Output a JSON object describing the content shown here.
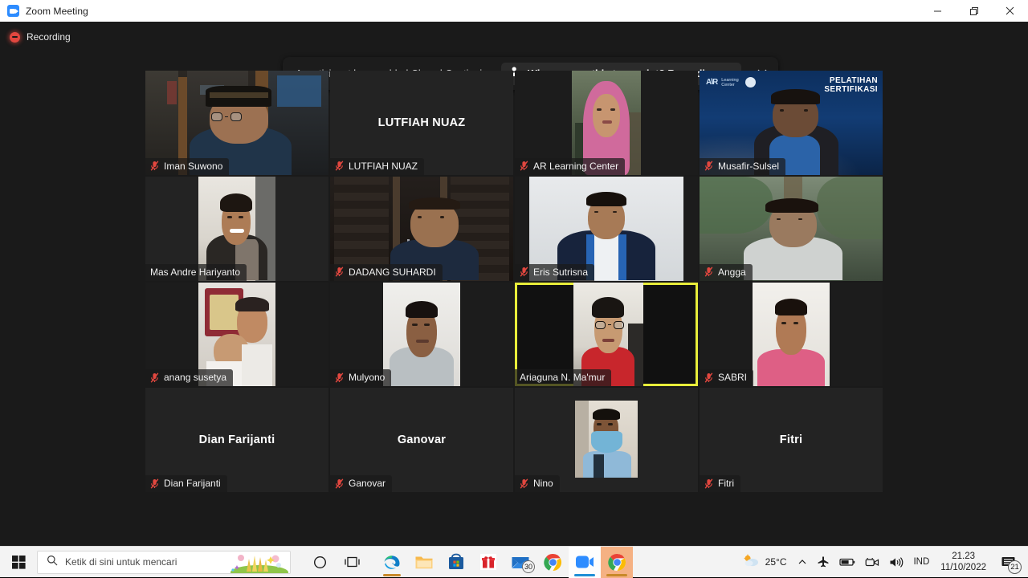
{
  "window": {
    "title": "Zoom Meeting",
    "app_icon": "zoom-icon",
    "controls": {
      "minimize": "–",
      "maximize": "❐",
      "close": "✕"
    }
  },
  "recording": {
    "label": "Recording",
    "icon": "recording-dot-icon"
  },
  "cc_banner": {
    "message": "A participant has enabled Closed Captioning",
    "pill_icon": "person-transcript-icon",
    "pill_label": "Who can see this transcript? Recording on",
    "close_icon": "close-icon"
  },
  "grid": {
    "active_border_color": "#e8ed3a",
    "participants": [
      {
        "name": "Iman Suwono",
        "muted": true,
        "video": true,
        "active": false,
        "kind": "video-shelf"
      },
      {
        "name": "LUTFIAH NUAZ",
        "muted": true,
        "video": false,
        "active": false,
        "kind": "name-only",
        "display_name": "LUTFIAH NUAZ"
      },
      {
        "name": "AR Learning Center",
        "muted": true,
        "video": true,
        "active": false,
        "kind": "video-hijab"
      },
      {
        "name": "Musafir-Sulsel",
        "muted": true,
        "video": true,
        "active": false,
        "kind": "video-backdrop",
        "backdrop_text_top": "PELATIHAN",
        "backdrop_text_bottom": "SERTIFIKASI",
        "backdrop_logo": "AR Learning Center"
      },
      {
        "name": "Mas Andre Hariyanto",
        "muted": false,
        "video": true,
        "active": false,
        "kind": "video-portrait-light"
      },
      {
        "name": "DADANG SUHARDI",
        "muted": true,
        "video": true,
        "active": false,
        "kind": "video-dark-room"
      },
      {
        "name": "Eris Sutrisna",
        "muted": true,
        "video": true,
        "active": false,
        "kind": "video-lanyard"
      },
      {
        "name": "Angga",
        "muted": true,
        "video": true,
        "active": false,
        "kind": "video-outdoor"
      },
      {
        "name": "anang susetya",
        "muted": true,
        "video": true,
        "active": false,
        "kind": "video-two-people"
      },
      {
        "name": "Mulyono",
        "muted": true,
        "video": true,
        "active": false,
        "kind": "video-portrait-white"
      },
      {
        "name": "Ariaguna N. Ma'mur",
        "muted": false,
        "video": true,
        "active": true,
        "kind": "video-red-shirt"
      },
      {
        "name": "SABRI",
        "muted": true,
        "video": true,
        "active": false,
        "kind": "video-pink"
      },
      {
        "name": "Dian Farijanti",
        "muted": true,
        "video": false,
        "active": false,
        "kind": "name-only",
        "display_name": "Dian Farijanti"
      },
      {
        "name": "Ganovar",
        "muted": true,
        "video": false,
        "active": false,
        "kind": "name-only",
        "display_name": "Ganovar"
      },
      {
        "name": "Nino",
        "muted": true,
        "video": true,
        "active": false,
        "kind": "video-mask"
      },
      {
        "name": "Fitri",
        "muted": true,
        "video": false,
        "active": false,
        "kind": "name-only",
        "display_name": "Fitri"
      }
    ]
  },
  "taskbar": {
    "start_icon": "windows-start-icon",
    "search": {
      "icon": "search-icon",
      "placeholder": "Ketik di sini untuk mencari"
    },
    "icons": [
      {
        "name": "cortana-icon",
        "label": ""
      },
      {
        "name": "task-view-icon",
        "label": ""
      },
      {
        "name": "edge-icon",
        "label": ""
      },
      {
        "name": "file-explorer-icon",
        "label": ""
      },
      {
        "name": "microsoft-store-icon",
        "label": ""
      },
      {
        "name": "gift-icon",
        "label": ""
      },
      {
        "name": "mail-icon",
        "label": "",
        "badge": "30"
      },
      {
        "name": "chrome-icon",
        "label": ""
      },
      {
        "name": "zoom-icon",
        "label": ""
      },
      {
        "name": "chrome-active-icon",
        "label": ""
      }
    ],
    "tray": {
      "weather_icon": "sun-cloud-icon",
      "temperature": "25°C",
      "overflow_icon": "chevron-up-icon",
      "airplane_icon": "airplane-mode-icon",
      "battery_icon": "battery-icon",
      "camera_icon": "camera-icon",
      "volume_icon": "volume-icon",
      "language": "IND",
      "time": "21.23",
      "date": "11/10/2022",
      "notification_icon": "notification-icon",
      "notification_count": "21"
    }
  }
}
